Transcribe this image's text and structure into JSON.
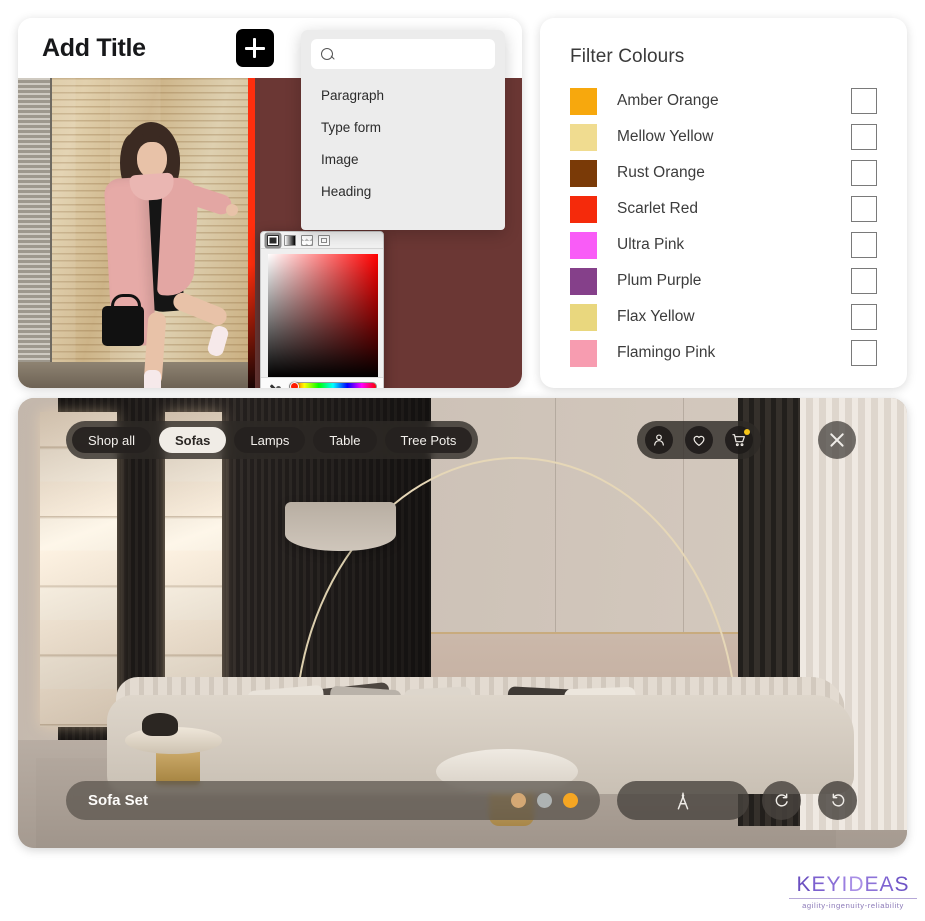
{
  "builder": {
    "title": "Add Title",
    "add_block_button": "+",
    "block_menu": {
      "search_placeholder": "",
      "search_value": "",
      "items": [
        "Paragraph",
        "Type form",
        "Image",
        "Heading"
      ]
    },
    "canvas_background_color": "#6b3734"
  },
  "color_picker": {
    "tools": [
      "solid-color-tab",
      "gradient-tab",
      "pattern-tab",
      "image-tab"
    ],
    "selected_tool": "solid-color-tab",
    "hue_color": "#ff1a00",
    "eyedropper": "eyedropper-icon"
  },
  "filter_panel": {
    "title": "Filter Colours",
    "colours": [
      {
        "name": "Amber Orange",
        "hex": "#F7A80D",
        "checked": false
      },
      {
        "name": "Mellow Yellow",
        "hex": "#F0DC90",
        "checked": false
      },
      {
        "name": "Rust Orange",
        "hex": "#7A3A07",
        "checked": false
      },
      {
        "name": "Scarlet Red",
        "hex": "#F52A0B",
        "checked": false
      },
      {
        "name": "Ultra Pink",
        "hex": "#F95CF7",
        "checked": false
      },
      {
        "name": "Plum Purple",
        "hex": "#85408A",
        "checked": false
      },
      {
        "name": "Flax Yellow",
        "hex": "#E9D77E",
        "checked": false
      },
      {
        "name": "Flamingo Pink",
        "hex": "#F79CB0",
        "checked": false
      }
    ]
  },
  "room_viewer": {
    "nav_pills": [
      {
        "label": "Shop all",
        "active": false
      },
      {
        "label": "Sofas",
        "active": true
      },
      {
        "label": "Lamps",
        "active": false
      },
      {
        "label": "Table",
        "active": false
      },
      {
        "label": "Tree Pots",
        "active": false
      }
    ],
    "actions": [
      {
        "name": "account-icon",
        "badge": false
      },
      {
        "name": "wishlist-heart-icon",
        "badge": false
      },
      {
        "name": "cart-icon",
        "badge": true,
        "badge_color": "#F5C518"
      }
    ],
    "close_label": "close-icon",
    "product": {
      "name": "Sofa Set",
      "colour_dots": [
        "#D4A874",
        "#AEB3B3",
        "#F5A623"
      ],
      "selected_dot_index": 2
    },
    "tools": [
      {
        "name": "measure-compass-icon"
      },
      {
        "name": "redo-icon"
      },
      {
        "name": "undo-icon"
      }
    ]
  },
  "brand": {
    "name": "KEYIDEAS",
    "letters": [
      "K",
      "E",
      "Y",
      "I",
      "D",
      "E",
      "A",
      "S"
    ],
    "tagline": "agility-ingenuity-reliability"
  }
}
